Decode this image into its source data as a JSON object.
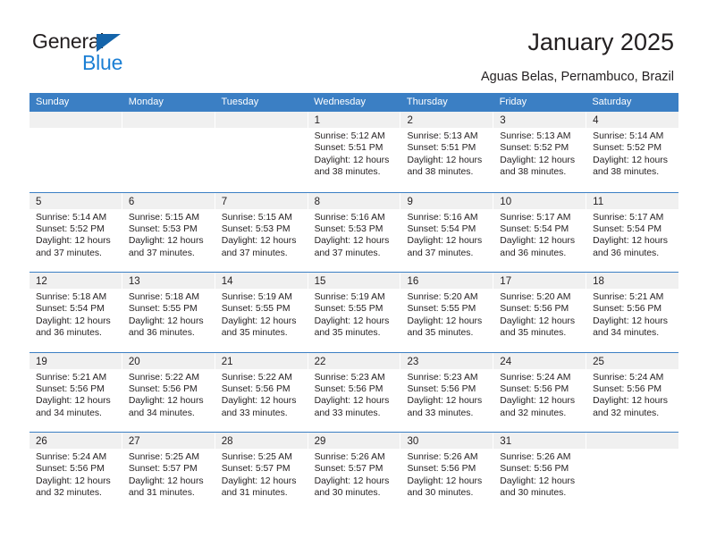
{
  "logo": {
    "word1": "General",
    "word2": "Blue",
    "triangle_color": "#1464aa",
    "blue_color": "#1b7fd4"
  },
  "header": {
    "title": "January 2025",
    "subtitle": "Aguas Belas, Pernambuco, Brazil"
  },
  "colors": {
    "header_band": "#3b7fc4",
    "daynum_band": "#f0f0f0",
    "text": "#231f20"
  },
  "weekdays": [
    "Sunday",
    "Monday",
    "Tuesday",
    "Wednesday",
    "Thursday",
    "Friday",
    "Saturday"
  ],
  "weeks": [
    [
      {
        "day": ""
      },
      {
        "day": ""
      },
      {
        "day": ""
      },
      {
        "day": "1",
        "sunrise": "Sunrise: 5:12 AM",
        "sunset": "Sunset: 5:51 PM",
        "daylight1": "Daylight: 12 hours",
        "daylight2": "and 38 minutes."
      },
      {
        "day": "2",
        "sunrise": "Sunrise: 5:13 AM",
        "sunset": "Sunset: 5:51 PM",
        "daylight1": "Daylight: 12 hours",
        "daylight2": "and 38 minutes."
      },
      {
        "day": "3",
        "sunrise": "Sunrise: 5:13 AM",
        "sunset": "Sunset: 5:52 PM",
        "daylight1": "Daylight: 12 hours",
        "daylight2": "and 38 minutes."
      },
      {
        "day": "4",
        "sunrise": "Sunrise: 5:14 AM",
        "sunset": "Sunset: 5:52 PM",
        "daylight1": "Daylight: 12 hours",
        "daylight2": "and 38 minutes."
      }
    ],
    [
      {
        "day": "5",
        "sunrise": "Sunrise: 5:14 AM",
        "sunset": "Sunset: 5:52 PM",
        "daylight1": "Daylight: 12 hours",
        "daylight2": "and 37 minutes."
      },
      {
        "day": "6",
        "sunrise": "Sunrise: 5:15 AM",
        "sunset": "Sunset: 5:53 PM",
        "daylight1": "Daylight: 12 hours",
        "daylight2": "and 37 minutes."
      },
      {
        "day": "7",
        "sunrise": "Sunrise: 5:15 AM",
        "sunset": "Sunset: 5:53 PM",
        "daylight1": "Daylight: 12 hours",
        "daylight2": "and 37 minutes."
      },
      {
        "day": "8",
        "sunrise": "Sunrise: 5:16 AM",
        "sunset": "Sunset: 5:53 PM",
        "daylight1": "Daylight: 12 hours",
        "daylight2": "and 37 minutes."
      },
      {
        "day": "9",
        "sunrise": "Sunrise: 5:16 AM",
        "sunset": "Sunset: 5:54 PM",
        "daylight1": "Daylight: 12 hours",
        "daylight2": "and 37 minutes."
      },
      {
        "day": "10",
        "sunrise": "Sunrise: 5:17 AM",
        "sunset": "Sunset: 5:54 PM",
        "daylight1": "Daylight: 12 hours",
        "daylight2": "and 36 minutes."
      },
      {
        "day": "11",
        "sunrise": "Sunrise: 5:17 AM",
        "sunset": "Sunset: 5:54 PM",
        "daylight1": "Daylight: 12 hours",
        "daylight2": "and 36 minutes."
      }
    ],
    [
      {
        "day": "12",
        "sunrise": "Sunrise: 5:18 AM",
        "sunset": "Sunset: 5:54 PM",
        "daylight1": "Daylight: 12 hours",
        "daylight2": "and 36 minutes."
      },
      {
        "day": "13",
        "sunrise": "Sunrise: 5:18 AM",
        "sunset": "Sunset: 5:55 PM",
        "daylight1": "Daylight: 12 hours",
        "daylight2": "and 36 minutes."
      },
      {
        "day": "14",
        "sunrise": "Sunrise: 5:19 AM",
        "sunset": "Sunset: 5:55 PM",
        "daylight1": "Daylight: 12 hours",
        "daylight2": "and 35 minutes."
      },
      {
        "day": "15",
        "sunrise": "Sunrise: 5:19 AM",
        "sunset": "Sunset: 5:55 PM",
        "daylight1": "Daylight: 12 hours",
        "daylight2": "and 35 minutes."
      },
      {
        "day": "16",
        "sunrise": "Sunrise: 5:20 AM",
        "sunset": "Sunset: 5:55 PM",
        "daylight1": "Daylight: 12 hours",
        "daylight2": "and 35 minutes."
      },
      {
        "day": "17",
        "sunrise": "Sunrise: 5:20 AM",
        "sunset": "Sunset: 5:56 PM",
        "daylight1": "Daylight: 12 hours",
        "daylight2": "and 35 minutes."
      },
      {
        "day": "18",
        "sunrise": "Sunrise: 5:21 AM",
        "sunset": "Sunset: 5:56 PM",
        "daylight1": "Daylight: 12 hours",
        "daylight2": "and 34 minutes."
      }
    ],
    [
      {
        "day": "19",
        "sunrise": "Sunrise: 5:21 AM",
        "sunset": "Sunset: 5:56 PM",
        "daylight1": "Daylight: 12 hours",
        "daylight2": "and 34 minutes."
      },
      {
        "day": "20",
        "sunrise": "Sunrise: 5:22 AM",
        "sunset": "Sunset: 5:56 PM",
        "daylight1": "Daylight: 12 hours",
        "daylight2": "and 34 minutes."
      },
      {
        "day": "21",
        "sunrise": "Sunrise: 5:22 AM",
        "sunset": "Sunset: 5:56 PM",
        "daylight1": "Daylight: 12 hours",
        "daylight2": "and 33 minutes."
      },
      {
        "day": "22",
        "sunrise": "Sunrise: 5:23 AM",
        "sunset": "Sunset: 5:56 PM",
        "daylight1": "Daylight: 12 hours",
        "daylight2": "and 33 minutes."
      },
      {
        "day": "23",
        "sunrise": "Sunrise: 5:23 AM",
        "sunset": "Sunset: 5:56 PM",
        "daylight1": "Daylight: 12 hours",
        "daylight2": "and 33 minutes."
      },
      {
        "day": "24",
        "sunrise": "Sunrise: 5:24 AM",
        "sunset": "Sunset: 5:56 PM",
        "daylight1": "Daylight: 12 hours",
        "daylight2": "and 32 minutes."
      },
      {
        "day": "25",
        "sunrise": "Sunrise: 5:24 AM",
        "sunset": "Sunset: 5:56 PM",
        "daylight1": "Daylight: 12 hours",
        "daylight2": "and 32 minutes."
      }
    ],
    [
      {
        "day": "26",
        "sunrise": "Sunrise: 5:24 AM",
        "sunset": "Sunset: 5:56 PM",
        "daylight1": "Daylight: 12 hours",
        "daylight2": "and 32 minutes."
      },
      {
        "day": "27",
        "sunrise": "Sunrise: 5:25 AM",
        "sunset": "Sunset: 5:57 PM",
        "daylight1": "Daylight: 12 hours",
        "daylight2": "and 31 minutes."
      },
      {
        "day": "28",
        "sunrise": "Sunrise: 5:25 AM",
        "sunset": "Sunset: 5:57 PM",
        "daylight1": "Daylight: 12 hours",
        "daylight2": "and 31 minutes."
      },
      {
        "day": "29",
        "sunrise": "Sunrise: 5:26 AM",
        "sunset": "Sunset: 5:57 PM",
        "daylight1": "Daylight: 12 hours",
        "daylight2": "and 30 minutes."
      },
      {
        "day": "30",
        "sunrise": "Sunrise: 5:26 AM",
        "sunset": "Sunset: 5:56 PM",
        "daylight1": "Daylight: 12 hours",
        "daylight2": "and 30 minutes."
      },
      {
        "day": "31",
        "sunrise": "Sunrise: 5:26 AM",
        "sunset": "Sunset: 5:56 PM",
        "daylight1": "Daylight: 12 hours",
        "daylight2": "and 30 minutes."
      },
      {
        "day": ""
      }
    ]
  ]
}
